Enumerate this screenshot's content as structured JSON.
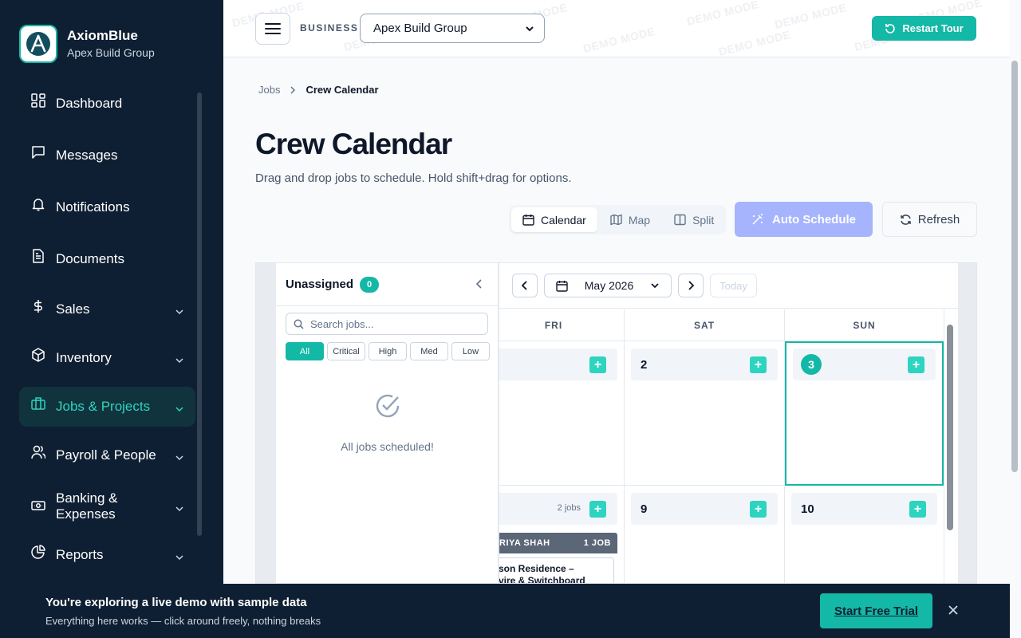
{
  "app": {
    "name": "AxiomBlue",
    "business": "Apex Build Group"
  },
  "colors": {
    "sidebar_bg": "#0f1f33",
    "accent": "#14b8a6",
    "auto_schedule_disabled": "#a5b4fc"
  },
  "sidebar": {
    "items": [
      {
        "label": "Dashboard",
        "icon": "dashboard-grid-icon",
        "expandable": false,
        "active": false
      },
      {
        "label": "Messages",
        "icon": "message-icon",
        "expandable": false,
        "active": false
      },
      {
        "label": "Notifications",
        "icon": "bell-icon",
        "expandable": false,
        "active": false
      },
      {
        "label": "Documents",
        "icon": "document-icon",
        "expandable": false,
        "active": false
      },
      {
        "label": "Sales",
        "icon": "dollar-icon",
        "expandable": true,
        "active": false
      },
      {
        "label": "Inventory",
        "icon": "box-icon",
        "expandable": true,
        "active": false
      },
      {
        "label": "Jobs & Projects",
        "icon": "briefcase-icon",
        "expandable": true,
        "active": true
      },
      {
        "label": "Payroll & People",
        "icon": "users-icon",
        "expandable": true,
        "active": false
      },
      {
        "label": "Banking & Expenses",
        "icon": "banknote-icon",
        "expandable": true,
        "active": false
      },
      {
        "label": "Reports",
        "icon": "pie-chart-icon",
        "expandable": true,
        "active": false
      }
    ]
  },
  "topbar": {
    "business_label": "BUSINESS",
    "business_selected": "Apex Build Group",
    "restart_tour": "Restart Tour",
    "watermark": "DEMO MODE"
  },
  "breadcrumb": {
    "parent": "Jobs",
    "current": "Crew Calendar"
  },
  "page": {
    "title": "Crew Calendar",
    "subtitle": "Drag and drop jobs to schedule. Hold shift+drag for options."
  },
  "toolbar": {
    "views": [
      {
        "label": "Calendar",
        "icon": "calendar-icon",
        "active": true
      },
      {
        "label": "Map",
        "icon": "map-icon",
        "active": false
      },
      {
        "label": "Split",
        "icon": "split-columns-icon",
        "active": false
      }
    ],
    "auto_schedule": "Auto Schedule",
    "refresh": "Refresh"
  },
  "unassigned": {
    "title": "Unassigned",
    "count": "0",
    "search_placeholder": "Search jobs...",
    "filters": [
      {
        "label": "All",
        "active": true
      },
      {
        "label": "Critical",
        "active": false
      },
      {
        "label": "High",
        "active": false
      },
      {
        "label": "Med",
        "active": false
      },
      {
        "label": "Low",
        "active": false
      }
    ],
    "empty_message": "All jobs scheduled!"
  },
  "calendar": {
    "month": "May 2026",
    "today_label": "Today",
    "days_of_week": [
      "FRI",
      "SAT",
      "SUN"
    ],
    "week1": {
      "sat": "2",
      "sun": "3"
    },
    "week2": {
      "fri_jobs": "2 jobs",
      "sat": "9",
      "sun": "10",
      "crew_name": "RIYA SHAH",
      "crew_jobs": "1 JOB",
      "job_title_line1": "son Residence –",
      "job_title_line2": "vire & Switchboard"
    }
  },
  "demo_banner": {
    "title": "You're exploring a live demo with sample data",
    "subtitle": "Everything here works — click around freely, nothing breaks",
    "cta": "Start Free Trial"
  }
}
